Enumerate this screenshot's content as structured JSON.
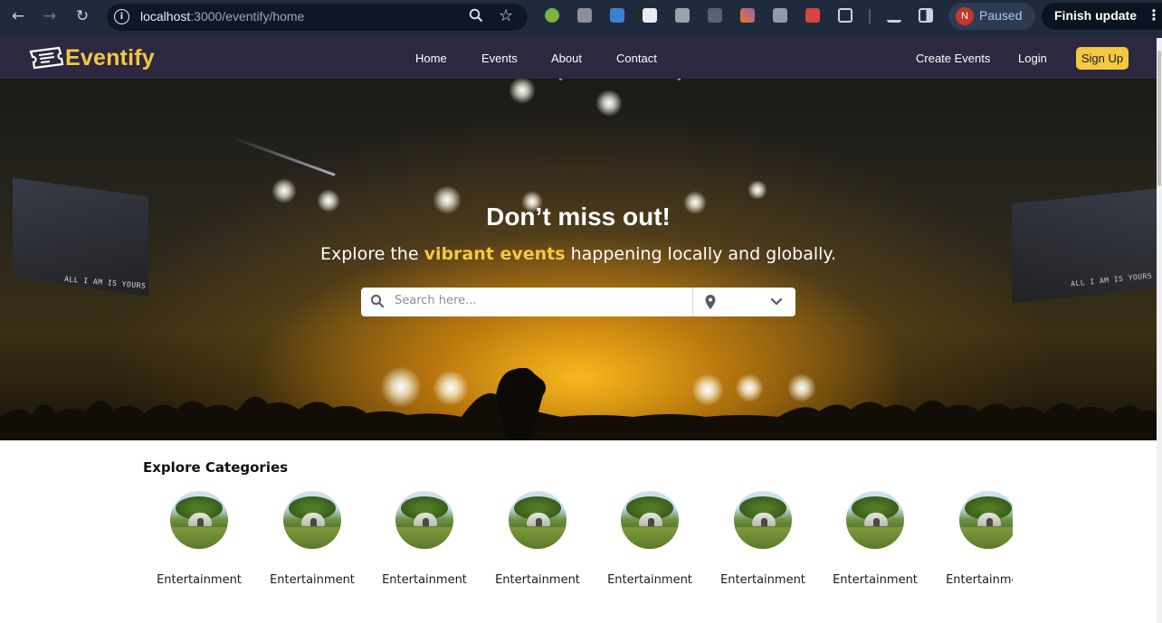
{
  "browser": {
    "url_host": "localhost",
    "url_rest": ":3000/eventify/home",
    "profile_initial": "N",
    "profile_status": "Paused",
    "update_label": "Finish update",
    "colors": {
      "chrome_bg": "#1f2a3d",
      "omnibox_bg": "#0f1726"
    }
  },
  "site": {
    "brand": "Eventify",
    "nav": {
      "home": "Home",
      "events": "Events",
      "about": "About",
      "contact": "Contact",
      "create_events": "Create Events",
      "login": "Login",
      "signup": "Sign Up"
    },
    "colors": {
      "navbar_bg": "#2b2840",
      "accent": "#f5c842"
    }
  },
  "hero": {
    "title": "Don’t miss out!",
    "subtitle_before": "Explore the ",
    "subtitle_highlight": "vibrant events",
    "subtitle_after": " happening locally and globally.",
    "screen_text": "ALL I AM IS YOURS",
    "search": {
      "placeholder": "Search here...",
      "location_value": ""
    }
  },
  "categories": {
    "title": "Explore Categories",
    "items": [
      {
        "label": "Entertainment"
      },
      {
        "label": "Entertainment"
      },
      {
        "label": "Entertainment"
      },
      {
        "label": "Entertainment"
      },
      {
        "label": "Entertainment"
      },
      {
        "label": "Entertainment"
      },
      {
        "label": "Entertainment"
      },
      {
        "label": "Entertainment"
      }
    ]
  }
}
